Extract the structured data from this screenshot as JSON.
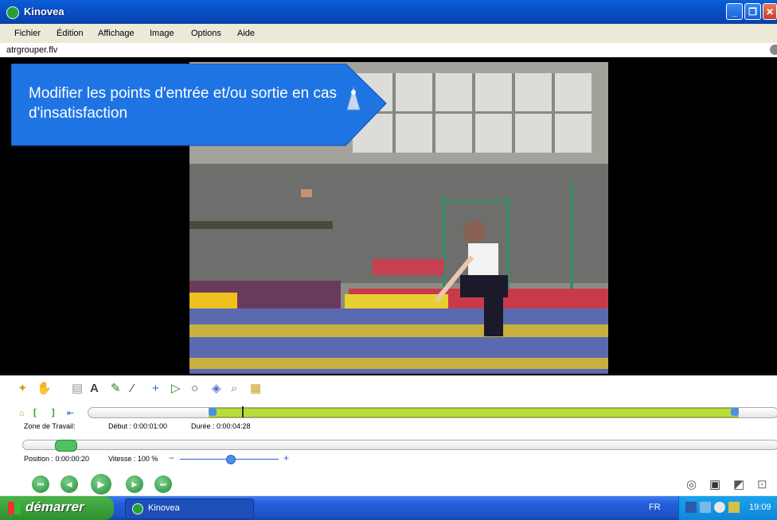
{
  "window": {
    "title": "Kinovea"
  },
  "menu": [
    "Fichier",
    "Édition",
    "Affichage",
    "Image",
    "Options",
    "Aide"
  ],
  "file": {
    "name": "atrgrouper.flv"
  },
  "callout": {
    "text": "Modifier les points d'entrée et/ou sortie en cas d'insatisfaction"
  },
  "workzone": {
    "label": "Zone de Travail:",
    "start": "Début : 0:00:01:00",
    "duration": "Durée : 0:00:04:28"
  },
  "playback": {
    "position": "Position : 0:00:00:20",
    "speed": "Vitesse : 100 %"
  },
  "taskbar": {
    "start_label": "démarrer",
    "task": "Kinovea",
    "lang": "FR",
    "clock": "19:09"
  }
}
